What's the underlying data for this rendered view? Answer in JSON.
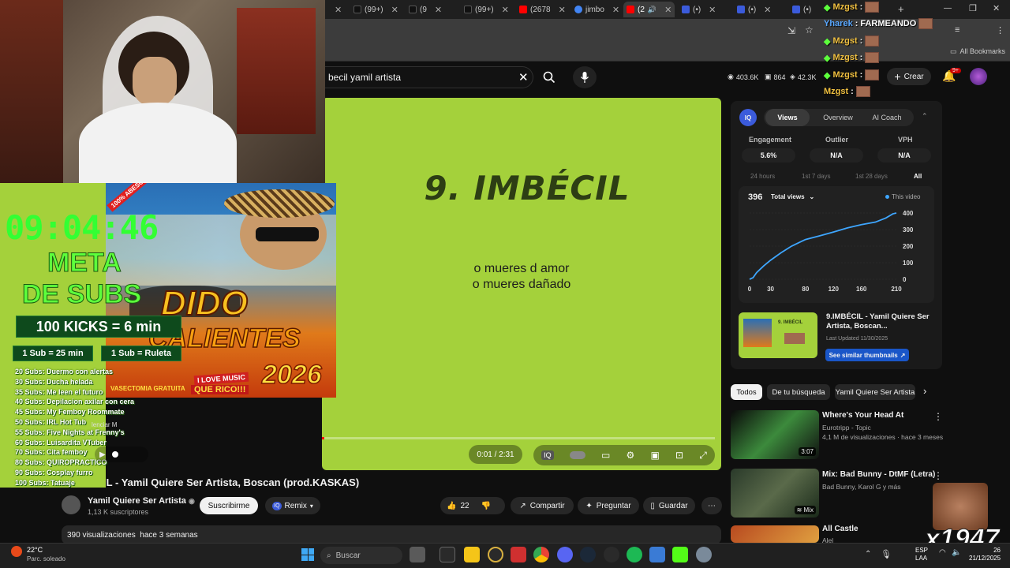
{
  "browser": {
    "tabs": [
      {
        "label": "(99+)",
        "color": "#111"
      },
      {
        "label": "(9",
        "color": "#111"
      },
      {
        "label": "(99+)",
        "color": "#111"
      },
      {
        "label": "(2678",
        "color": "#ff0000"
      },
      {
        "label": "jimbo",
        "color": "#4285f4"
      },
      {
        "label": "(2",
        "color": "#ff0000"
      },
      {
        "label": "(•)",
        "color": "#3b5bdb"
      },
      {
        "label": "(•)",
        "color": "#3b5bdb"
      },
      {
        "label": "(•)",
        "color": "#3b5bdb"
      }
    ],
    "bookmarks_label": "All Bookmarks"
  },
  "youtube": {
    "search_value": "becil yamil artista",
    "stats": {
      "views": "403.6K",
      "comments": "864",
      "likes": "42.3K"
    },
    "create_label": "Crear",
    "notif_badge": "9+"
  },
  "video": {
    "song_title_on_screen": "9. IMBÉCIL",
    "lyric_line1": "o mueres d amor",
    "lyric_line2": "o mueres dañado",
    "time": "0:01 / 2:31",
    "progress_fraction": 0.0066,
    "title": "IBÉCIL - Yamil Quiere Ser Artista, Boscan (prod.KASKAS)",
    "channel_name": "Yamil Quiere Ser Artista",
    "channel_subs": "1,13 K suscriptores",
    "subscribe_label": "Suscribirme",
    "remix_label": "Remix",
    "likes": "22",
    "share_label": "Compartir",
    "ask_label": "Preguntar",
    "save_label": "Guardar",
    "description_meta": "390 visualizaciones  hace 3 semanas"
  },
  "panel": {
    "tabs": [
      "Views",
      "Overview",
      "AI Coach"
    ],
    "metrics": [
      {
        "label": "Engagement",
        "value": "5.6%"
      },
      {
        "label": "Outlier",
        "value": "N/A"
      },
      {
        "label": "VPH",
        "value": "N/A"
      }
    ],
    "ranges": [
      "24 hours",
      "1st 7 days",
      "1st 28 days",
      "All"
    ],
    "total_views_value": "396",
    "total_views_label": "Total views",
    "legend_label": "This video",
    "thumb_title": "9.IMBÉCIL - Yamil Quiere Ser Artista, Boscan...",
    "thumb_updated": "Last Updated 11/30/2025",
    "similar_label": "See similar thumbnails"
  },
  "chart_data": {
    "type": "line",
    "title": "",
    "xlabel": "",
    "ylabel": "",
    "x": [
      0,
      5,
      10,
      20,
      30,
      45,
      60,
      80,
      100,
      120,
      140,
      160,
      180,
      195,
      205,
      210
    ],
    "y": [
      0,
      10,
      40,
      80,
      115,
      160,
      200,
      240,
      262,
      285,
      310,
      330,
      345,
      370,
      395,
      400
    ],
    "xlim": [
      0,
      210
    ],
    "ylim": [
      0,
      400
    ],
    "xticks": [
      0,
      30,
      80,
      120,
      160,
      210
    ],
    "yticks": [
      0,
      100,
      200,
      300,
      400
    ],
    "grid": true,
    "color": "#3ea6ff",
    "legend": "top-right"
  },
  "chips": [
    "Todos",
    "De tu búsqueda",
    "Yamil Quiere Ser Artista"
  ],
  "recommendations": [
    {
      "title": "Where's Your Head At",
      "channel": "Eurotripp - Topic",
      "meta": "4,1 M de visualizaciones · hace 3 meses",
      "duration": "3:07"
    },
    {
      "title": "Mix: Bad Bunny - DtMF (Letra)",
      "channel": "Bad Bunny, Karol G y más",
      "meta": "",
      "duration": "Mix"
    },
    {
      "title": "All Castle",
      "channel": "Alel",
      "meta": "",
      "duration": ""
    }
  ],
  "overlay": {
    "timer": "09:04:46",
    "goal_line1": "META",
    "goal_line2": "DE SUBS",
    "kicks": "100 KICKS = 6 min",
    "sub1": "1 Sub = 25 min",
    "sub2": "1 Sub = Ruleta",
    "goals": [
      "20 Subs: Duermo con alertas",
      "30 Subs: Ducha helada",
      "35 Subs: Me leen el futuro",
      "40 Subs: Depilacion axilar con cera",
      "45 Subs: My Femboy Roommate",
      "50 Subs: IRL Hot Tub",
      "55 Subs: Five Nights at Frenny's",
      "60 Subs: Luisardita VTuber",
      "70 Subs: Cita femboy",
      "80 Subs: QUIROPRACTICO",
      "90 Subs: Cosplay furro",
      "100 Subs: Tatuaje"
    ],
    "album_word1": "DIDO",
    "album_word2": "CALIENTES",
    "album_year": "2026",
    "album_tag1": "I LOVE MUSIC",
    "album_tag2": "QUE RICO!!!",
    "album_tag3": "VASECTOMIA GRATUITA",
    "album_badge": "100% ABESO",
    "album_caption": "lenciar  M",
    "watermark": "x1947"
  },
  "chat": [
    {
      "user": "Mzgst",
      "msg": "",
      "color": "#f0c040"
    },
    {
      "user": "Yharek",
      "msg": "FARMEANDO",
      "color": "#5aa8ff"
    },
    {
      "user": "Mzgst",
      "msg": "",
      "color": "#f0c040"
    },
    {
      "user": "Mzgst",
      "msg": "",
      "color": "#f0c040"
    },
    {
      "user": "Mzgst",
      "msg": "",
      "color": "#f0c040"
    },
    {
      "user": "Mzgst",
      "msg": "",
      "color": "#f0c040"
    }
  ],
  "taskbar": {
    "weather_temp": "22°C",
    "weather_desc": "Parc. soleado",
    "search_placeholder": "Buscar",
    "lang1": "ESP",
    "lang2": "LAA",
    "time": "26",
    "date": "21/12/2025"
  }
}
